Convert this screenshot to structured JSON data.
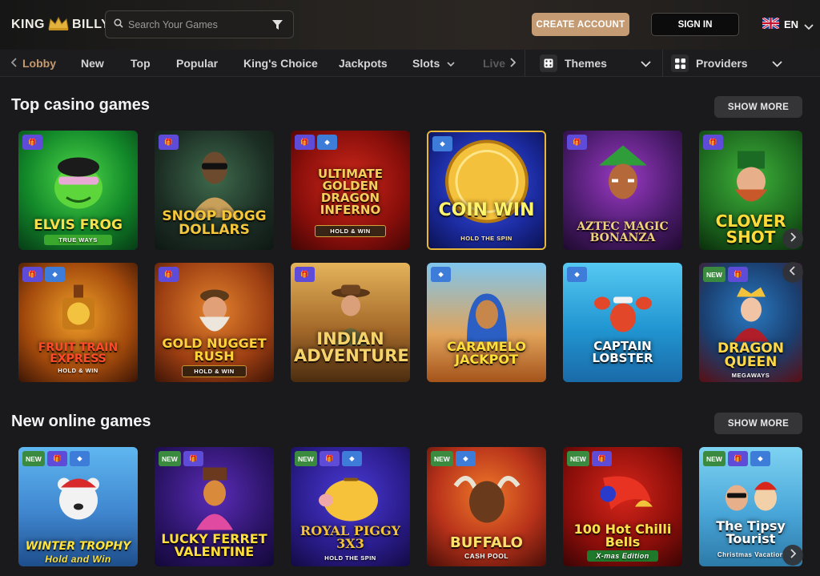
{
  "header": {
    "logo_left": "KING",
    "logo_right": "BILLY",
    "search_placeholder": "Search Your Games",
    "create_account": "CREATE ACCOUNT",
    "sign_in": "SIGN IN",
    "language": "EN"
  },
  "nav": {
    "items": [
      "Lobby",
      "New",
      "Top",
      "Popular",
      "King's Choice",
      "Jackpots",
      "Slots",
      "Live"
    ],
    "themes": "Themes",
    "providers": "Providers"
  },
  "sections": {
    "top": {
      "title": "Top casino games",
      "show_more": "SHOW MORE"
    },
    "new": {
      "title": "New online games",
      "show_more": "SHOW MORE"
    }
  },
  "top_games": [
    {
      "name": "Elvis Frog",
      "sub": "TRUE WAYS",
      "badges": [
        "gift"
      ]
    },
    {
      "name": "Snoop Dogg Dollars",
      "sub": "",
      "badges": [
        "gift"
      ]
    },
    {
      "name": "Ultimate Golden Dragon Inferno",
      "sub": "HOLD & WIN",
      "badges": [
        "gift",
        "diamond"
      ]
    },
    {
      "name": "Coin Win",
      "sub": "HOLD THE SPIN",
      "badges": [
        "diamond"
      ]
    },
    {
      "name": "Aztec Magic Bonanza",
      "sub": "",
      "badges": [
        "gift"
      ]
    },
    {
      "name": "Clover Shot",
      "sub": "",
      "badges": [
        "gift"
      ]
    },
    {
      "name": "Fruit Train Express",
      "sub": "HOLD & WIN",
      "badges": [
        "gift",
        "diamond"
      ]
    },
    {
      "name": "Gold Nugget Rush",
      "sub": "HOLD & WIN",
      "badges": [
        "gift"
      ]
    },
    {
      "name": "Indian Adventure",
      "sub": "",
      "badges": [
        "gift"
      ]
    },
    {
      "name": "Caramelo Jackpot",
      "sub": "",
      "badges": [
        "diamond"
      ]
    },
    {
      "name": "Captain Lobster",
      "sub": "",
      "badges": [
        "diamond"
      ]
    },
    {
      "name": "Dragon Queen",
      "sub": "MEGAWAYS",
      "badges": [
        "new",
        "gift"
      ]
    }
  ],
  "new_games": [
    {
      "name": "Winter Trophy",
      "sub": "Hold and Win",
      "badges": [
        "new",
        "gift",
        "diamond"
      ]
    },
    {
      "name": "Lucky Ferret Valentine",
      "sub": "",
      "badges": [
        "new",
        "gift"
      ]
    },
    {
      "name": "Royal Piggy 3x3",
      "sub": "HOLD THE SPIN",
      "badges": [
        "new",
        "gift",
        "diamond"
      ]
    },
    {
      "name": "Buffalo",
      "sub": "CASH POOL",
      "badges": [
        "new",
        "diamond"
      ]
    },
    {
      "name": "100 Hot Chilli Bells",
      "sub": "X-mas Edition",
      "badges": [
        "new",
        "gift"
      ]
    },
    {
      "name": "The Tipsy Tourist",
      "sub": "Christmas Vacation",
      "badges": [
        "new",
        "gift",
        "diamond"
      ]
    }
  ],
  "badge_labels": {
    "new": "NEW"
  },
  "colors": {
    "accent": "#c79a6e",
    "create_button": "#c49b73",
    "badge_gift": "#5e4bd8",
    "badge_diamond": "#3d7dd9",
    "badge_new": "#3a8a3f"
  }
}
